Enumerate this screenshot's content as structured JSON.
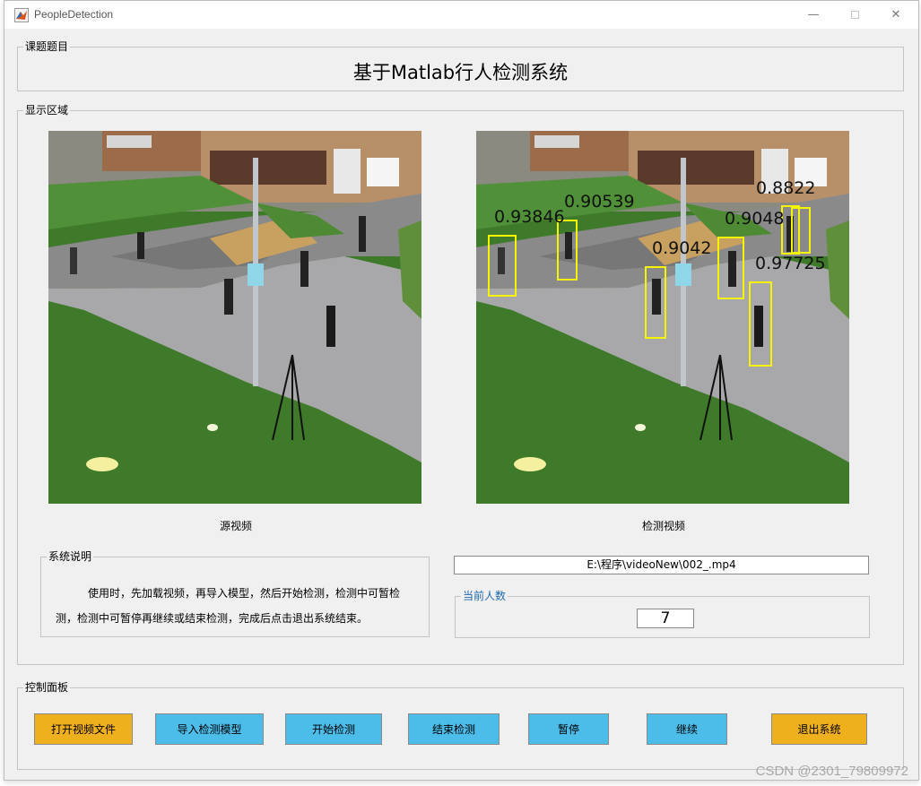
{
  "window": {
    "title": "PeopleDetection"
  },
  "topic_panel": {
    "label": "课题题目",
    "heading": "基于Matlab行人检测系统"
  },
  "display_panel": {
    "label": "显示区域",
    "source_caption": "源视频",
    "detect_caption": "检测视频",
    "detections": [
      "0.93846",
      "0.90539",
      "0.8822",
      "0.9048",
      "0.9042",
      "0.97725"
    ]
  },
  "description_panel": {
    "label": "系统说明",
    "text": "使用时，先加载视频，再导入模型，然后开始检测，检测中可暂检测，检测中可暂停再继续或结束检测，完成后点击退出系统结束。"
  },
  "file_path": "E:\\程序\\videoNew\\002_.mp4",
  "count_panel": {
    "label": "当前人数",
    "value": "7"
  },
  "control_panel": {
    "label": "控制面板",
    "buttons": {
      "open_video": "打开视频文件",
      "import_model": "导入检测模型",
      "start_detect": "开始检测",
      "end_detect": "结束检测",
      "pause": "暂停",
      "resume": "继续",
      "exit": "退出系统"
    }
  },
  "watermark": "CSDN @2301_79809972",
  "colors": {
    "orange_button": "#eeb01d",
    "blue_button": "#4cbce9",
    "detection_box": "#f5f500",
    "count_label": "#1e6ab0"
  },
  "icons": [
    "matlab-icon",
    "minimize-icon",
    "maximize-icon",
    "close-icon"
  ]
}
